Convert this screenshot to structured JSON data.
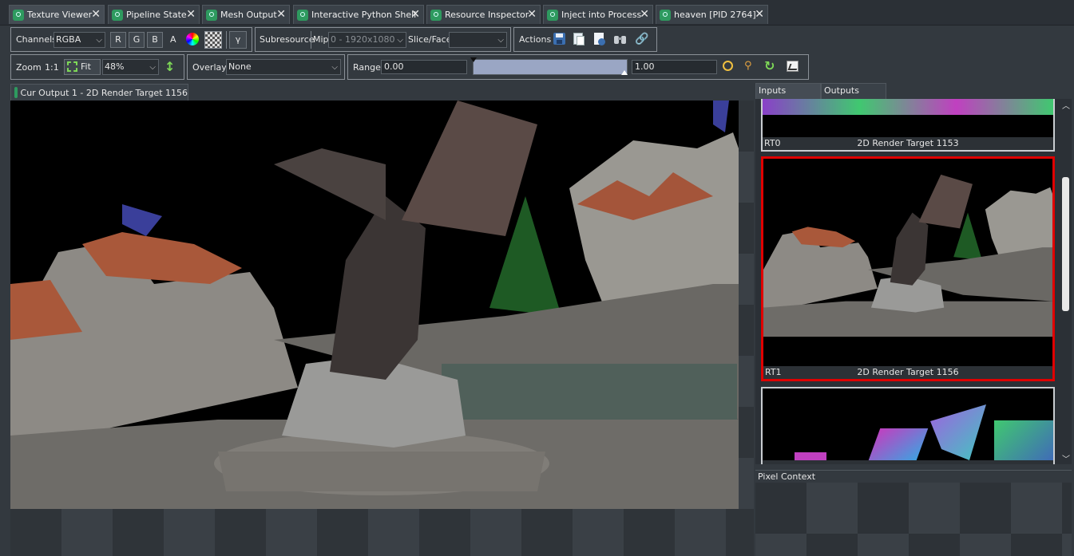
{
  "tabs": [
    {
      "label": "Texture Viewer",
      "active": true
    },
    {
      "label": "Pipeline State",
      "active": false
    },
    {
      "label": "Mesh Output",
      "active": false
    },
    {
      "label": "Interactive Python Shell",
      "active": false
    },
    {
      "label": "Resource Inspector",
      "active": false
    },
    {
      "label": "Inject into Process",
      "active": false
    },
    {
      "label": "heaven [PID 2764]",
      "active": false
    }
  ],
  "toolbar1": {
    "channels_label": "Channels",
    "channels_value": "RGBA",
    "r": "R",
    "g": "G",
    "b": "B",
    "a": "A",
    "gamma": "γ",
    "subresource_label": "Subresource",
    "mip_label": "Mip",
    "mip_value": "0 - 1920x1080",
    "slice_label": "Slice/Face",
    "slice_value": "",
    "actions_label": "Actions"
  },
  "toolbar2": {
    "zoom_label": "Zoom",
    "one_to_one": "1:1",
    "fit_label": "Fit",
    "zoom_value": "48%",
    "overlay_label": "Overlay",
    "overlay_value": "None",
    "range_label": "Range",
    "range_min": "0.00",
    "range_max": "1.00"
  },
  "subtab": {
    "label": "Cur Output 1 - 2D Render Target 1156"
  },
  "panel_tabs": {
    "inputs": "Inputs",
    "outputs": "Outputs"
  },
  "thumbnails": [
    {
      "slot": "RT0",
      "name": "2D Render Target 1153",
      "selected": false
    },
    {
      "slot": "RT1",
      "name": "2D Render Target 1156",
      "selected": true
    },
    {
      "slot": "",
      "name": "",
      "selected": false
    }
  ],
  "pixel_context": {
    "label": "Pixel Context"
  },
  "colors": {
    "accent_green": "#2e9a5f",
    "selected_border": "#e00000",
    "background": "#33393f"
  }
}
